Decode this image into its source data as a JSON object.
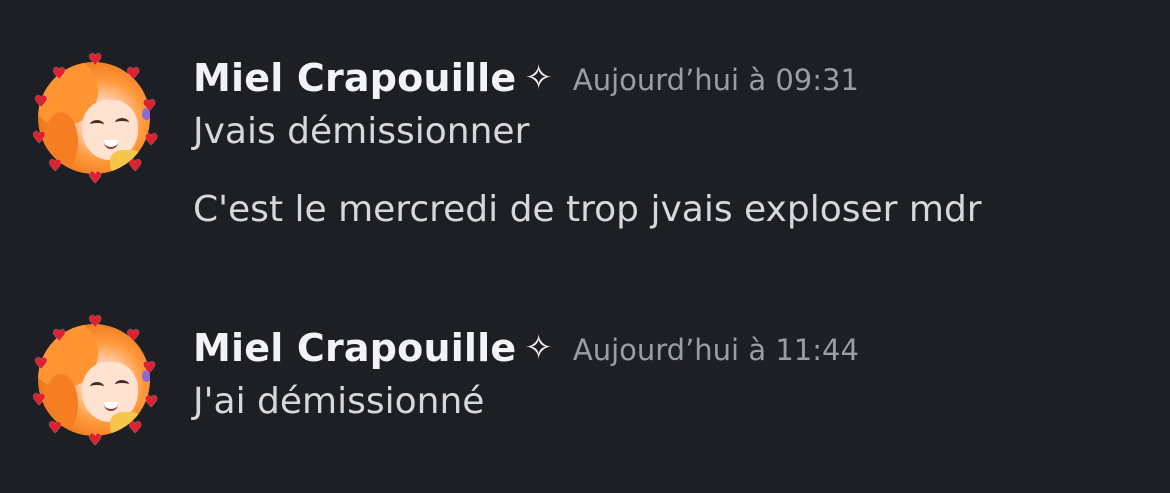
{
  "messages": [
    {
      "author": "Miel  Crapouille",
      "badge_icon": "sparkle-icon",
      "timestamp": "Aujourd’hui à 09:31",
      "lines": [
        "Jvais démissionner",
        "C'est le mercredi de trop jvais exploser mdr"
      ]
    },
    {
      "author": "Miel  Crapouille",
      "badge_icon": "sparkle-icon",
      "timestamp": "Aujourd’hui à 11:44",
      "lines": [
        "J'ai démissionné"
      ]
    }
  ],
  "colors": {
    "background": "#1e1f24",
    "username": "#f2f3f5",
    "timestamp": "#9a9ca6",
    "message_text": "#d6d8dd",
    "heart": "#e0202f"
  }
}
